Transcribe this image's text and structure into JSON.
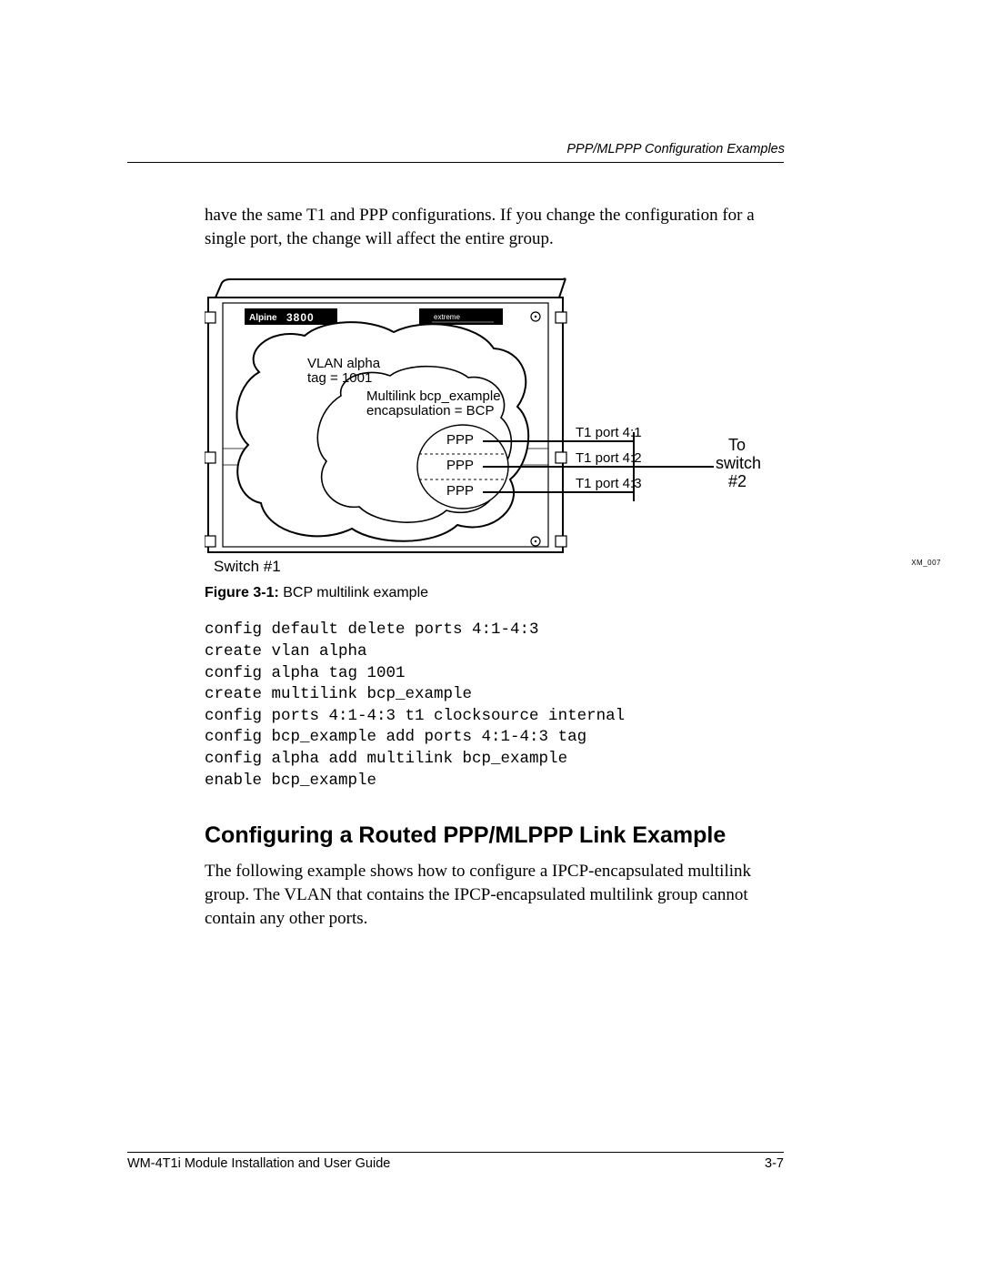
{
  "header": {
    "running_head": "PPP/MLPPP Configuration Examples"
  },
  "paragraphs": {
    "intro": "have the same T1 and PPP configurations. If you change the configuration for a single port, the change will affect the entire group."
  },
  "figure": {
    "number_label": "Figure 3-1:",
    "caption": "BCP multilink example",
    "device_model": "Alpine 3800",
    "brand": "extreme",
    "vlan_line1": "VLAN alpha",
    "vlan_line2": "tag = 1001",
    "multilink_line1": "Multilink bcp_example",
    "multilink_line2": "encapsulation = BCP",
    "ppp": "PPP",
    "t1_port_1": "T1 port 4:1",
    "t1_port_2": "T1 port 4:2",
    "t1_port_3": "T1 port 4:3",
    "to_switch_line1": "To",
    "to_switch_line2": "switch",
    "to_switch_line3": "#2",
    "switch_label": "Switch  #1",
    "xm_code": "XM_007"
  },
  "code": "config default delete ports 4:1-4:3\ncreate vlan alpha\nconfig alpha tag 1001\ncreate multilink bcp_example\nconfig ports 4:1-4:3 t1 clocksource internal\nconfig bcp_example add ports 4:1-4:3 tag\nconfig alpha add multilink bcp_example\nenable bcp_example",
  "section": {
    "heading": "Configuring a Routed PPP/MLPPP Link Example",
    "body": "The following example shows how to configure a IPCP-encapsulated multilink group. The VLAN that contains the IPCP-encapsulated multilink group cannot contain any other ports."
  },
  "footer": {
    "left": "WM-4T1i Module Installation and User Guide",
    "right": "3-7"
  }
}
